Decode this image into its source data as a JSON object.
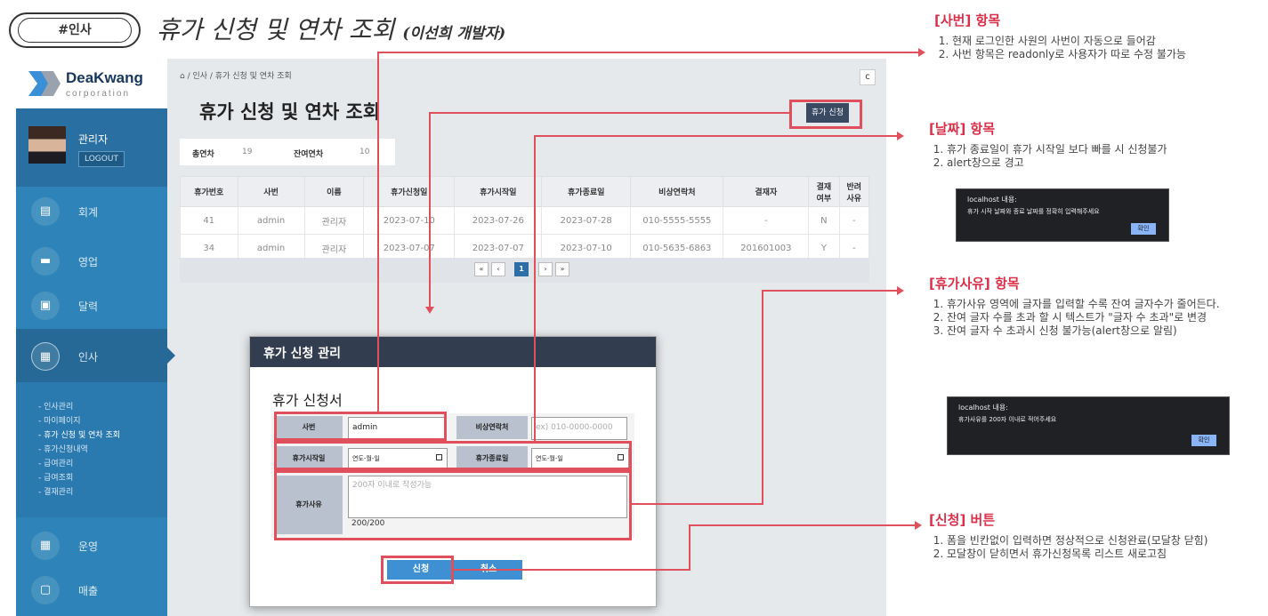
{
  "header": {
    "tag": "#인사",
    "title": "휴가 신청 및 연차 조회",
    "author": "(이선희 개발자)"
  },
  "app": {
    "logo": {
      "name": "DeaKwang",
      "sub": "corporation"
    },
    "user": {
      "name": "관리자",
      "logout": "LOGOUT"
    },
    "nav": [
      {
        "icon": "▤",
        "label": "회계"
      },
      {
        "icon": "▬",
        "label": "영업"
      },
      {
        "icon": "▣",
        "label": "달력"
      },
      {
        "icon": "▦",
        "label": "인사"
      },
      {
        "icon": "▦",
        "label": "운영"
      },
      {
        "icon": "▢",
        "label": "매출"
      }
    ],
    "submenu": [
      "- 인사관리",
      "- 마이페이지",
      "- 휴가 신청 및 연차 조회",
      "- 휴가신청내역",
      "- 급여관리",
      "- 급여조회",
      "- 결재관리"
    ],
    "breadcrumb": "/ 인사 / 휴가 신청 및 연차 조회",
    "refresh": "c",
    "page_title": "휴가 신청 및 연차 조회",
    "apply_button": "휴가 신청",
    "summary": {
      "total_label": "총연차",
      "total": "19",
      "remain_label": "잔여연차",
      "remain": "10"
    },
    "table": {
      "headers": [
        "휴가번호",
        "사번",
        "이름",
        "휴가신청일",
        "휴가시작일",
        "휴가종료일",
        "비상연락처",
        "결재자",
        "결재\n여부",
        "반려\n사유"
      ],
      "rows": [
        [
          "41",
          "admin",
          "관리자",
          "2023-07-10",
          "2023-07-26",
          "2023-07-28",
          "010-5555-5555",
          "-",
          "N",
          "-"
        ],
        [
          "34",
          "admin",
          "관리자",
          "2023-07-07",
          "2023-07-07",
          "2023-07-10",
          "010-5635-6863",
          "201601003",
          "Y",
          "-"
        ]
      ]
    },
    "pager": {
      "first": "«",
      "prev": "‹",
      "current": "1",
      "next": "›",
      "last": "»"
    }
  },
  "modal": {
    "header": "휴가 신청 관리",
    "title": "휴가 신청서",
    "emp_label": "사번",
    "emp_value": "admin",
    "phone_label": "비상연락처",
    "phone_placeholder": "ex) 010-0000-0000",
    "start_label": "휴가시작일",
    "start_value": "연도-월-일",
    "end_label": "휴가종료일",
    "end_value": "연도-월-일",
    "reason_label": "휴가사유",
    "reason_placeholder": "200자 이내로 작성가능",
    "counter": "200/200",
    "submit": "신청",
    "cancel": "취소"
  },
  "annotations": [
    {
      "title": "[사번] 항목",
      "items": [
        "현재 로그인한 사원의 사번이 자동으로 들어감",
        "사번 항목은 readonly로 사용자가 따로 수정 불가능"
      ]
    },
    {
      "title": "[날짜] 항목",
      "items": [
        "휴가 종료일이 휴가 시작일 보다 빠를 시 신청불가",
        "alert창으로 경고"
      ]
    },
    {
      "title": "[휴가사유] 항목",
      "items": [
        "휴가사유 영역에 글자를 입력할 수록 잔여 글자수가 줄어든다.",
        "잔여 글자 수를 초과 할 시 텍스트가 \"글자 수 초과\"로 변경",
        "잔여 글자 수 초과시 신청 불가능(alert창으로 알림)"
      ]
    },
    {
      "title": "[신청] 버튼",
      "items": [
        "폼을 빈칸없이 입력하면 정상적으로 신청완료(모달창 닫힘)",
        "모달창이 닫히면서 휴가신청목록 리스트 새로고침"
      ]
    }
  ],
  "alerts": [
    {
      "title": "localhost 내용:",
      "message": "휴가 시작 날짜와 종료 날짜를 정확히 입력해주세요",
      "button": "확인"
    },
    {
      "title": "localhost 내용:",
      "message": "휴가사유를 200자 이내로 적어주세요",
      "button": "확인"
    }
  ],
  "colors": {
    "accent": "#e0505c",
    "sidebar": "#2e84b8",
    "modal_header": "#333d50",
    "button": "#3e90d2"
  }
}
